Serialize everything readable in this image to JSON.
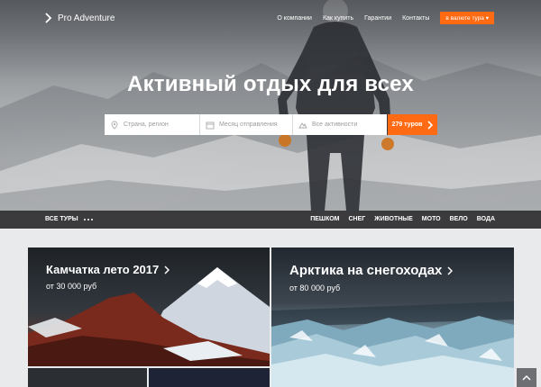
{
  "header": {
    "logo_text": "Pro Adventure",
    "nav": [
      "О компании",
      "Как купить",
      "Гарантии",
      "Контакты"
    ],
    "currency_label": "в валюте тура"
  },
  "hero": {
    "title": "Активный отдых для всех",
    "search": {
      "destination_placeholder": "Страна, регион",
      "month_placeholder": "Месяц отправления",
      "activity_placeholder": "Все активности",
      "button_label": "279 туров"
    }
  },
  "category_bar": {
    "all_tours": "ВСЕ ТУРЫ",
    "categories": [
      "ПЕШКОМ",
      "СНЕГ",
      "ЖИВОТНЫЕ",
      "МОТО",
      "ВЕЛО",
      "ВОДА"
    ]
  },
  "tours": [
    {
      "title": "Камчатка лето 2017",
      "price": "от 30 000 руб"
    },
    {
      "title": "Арктика на снегоходах",
      "price": "от 80 000 руб"
    }
  ],
  "colors": {
    "accent": "#ff6a13",
    "bar": "#3b3b3d"
  }
}
